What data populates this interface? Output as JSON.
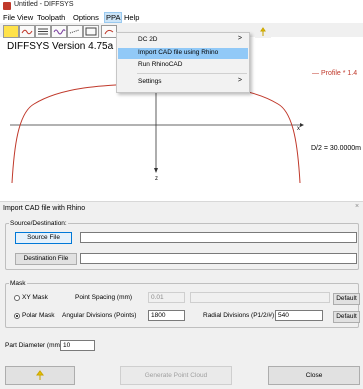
{
  "window": {
    "title": "Untitled - DIFFSYS",
    "menus": [
      "File",
      "View",
      "Toolpath",
      "Options",
      "PPA",
      "Help"
    ]
  },
  "ppa_menu": {
    "items": [
      {
        "label": "DC 2D",
        "submenu": true
      },
      {
        "label": "Import CAD file using Rhino",
        "submenu": false
      },
      {
        "label": "Run RhinoCAD",
        "submenu": false
      },
      {
        "label": "Settings",
        "submenu": true
      }
    ]
  },
  "canvas": {
    "version": "DIFFSYS Version 4.75a",
    "profile_label": "— Profile * 1.4",
    "d2_label": "D/2 = 30.0000m",
    "axis_x": "x",
    "axis_z": "z"
  },
  "dialog": {
    "title": "Import CAD file with Rhino",
    "source_group": "Source/Destination:",
    "source_button": "Source File",
    "source_value": "",
    "destination_button": "Destination File",
    "destination_value": "",
    "mask_group": "Mask",
    "xy_mask_label": "XY Mask",
    "xy_mask_selected": false,
    "point_spacing_label": "Point Spacing (mm)",
    "point_spacing_value": "0.01",
    "default_label": "Default",
    "polar_mask_label": "Polar Mask",
    "polar_mask_selected": true,
    "angular_divisions_label": "Angular Divisions (Points)",
    "angular_divisions_value": "1800",
    "radial_divisions_label": "Radial Divisions (P1/2/#)",
    "radial_divisions_value": "540",
    "part_diameter_label": "Part Diameter (mm)",
    "part_diameter_value": "10",
    "generate_label": "Generate Point Cloud",
    "close_label": "Close"
  },
  "colors": {
    "profile": "#c0392b",
    "menu_highlight": "#91c9f7"
  }
}
